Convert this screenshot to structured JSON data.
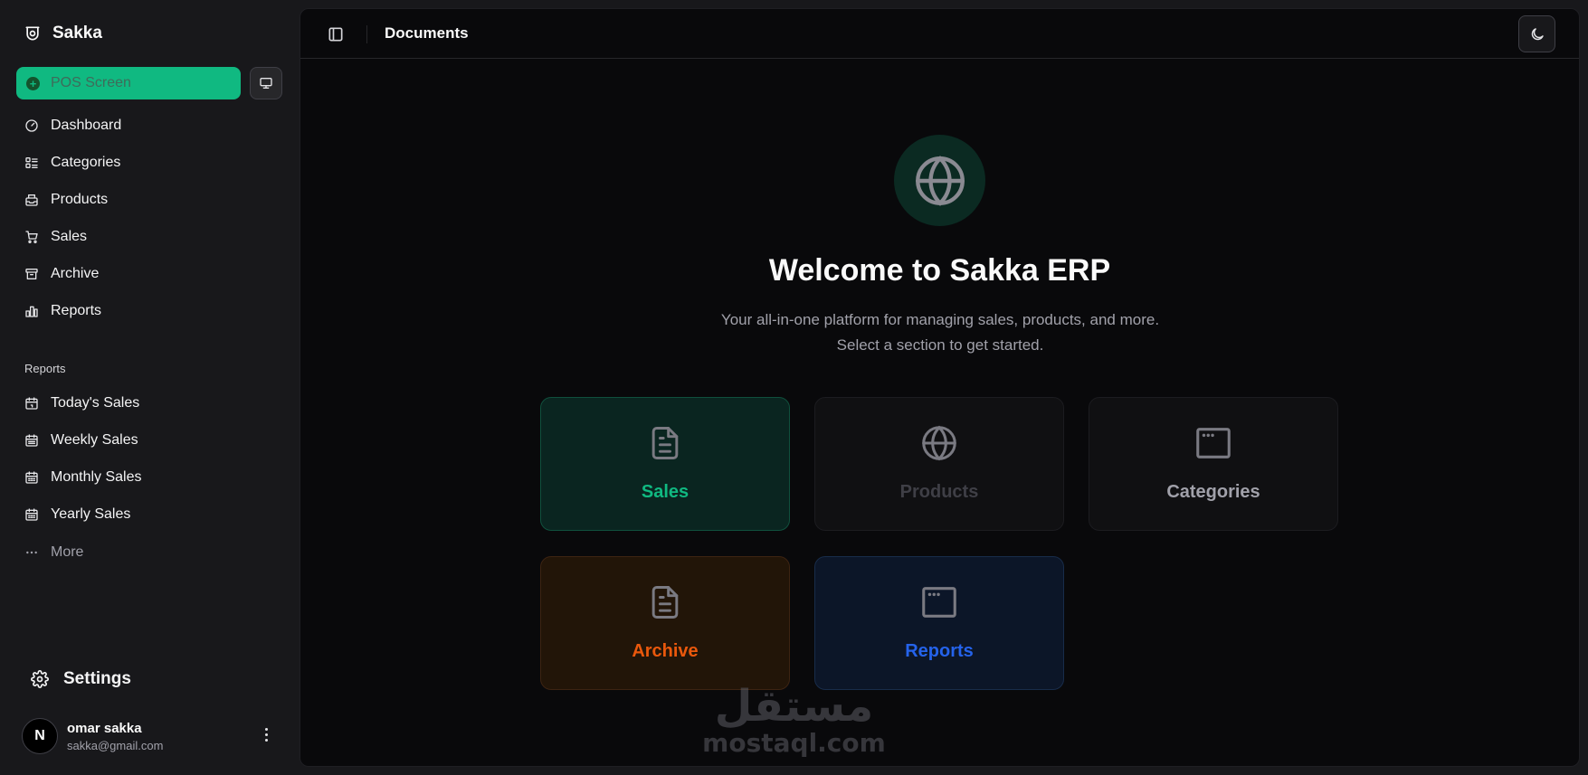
{
  "app": {
    "brand_name": "Sakka",
    "accent_color": "#10b981"
  },
  "sidebar": {
    "pos_button_label": "POS Screen",
    "nav_items": [
      {
        "label": "Dashboard",
        "icon": "gauge-icon"
      },
      {
        "label": "Categories",
        "icon": "list-icon"
      },
      {
        "label": "Products",
        "icon": "inbox-icon"
      },
      {
        "label": "Sales",
        "icon": "cart-icon"
      },
      {
        "label": "Archive",
        "icon": "archive-icon"
      },
      {
        "label": "Reports",
        "icon": "bar-chart-icon"
      }
    ],
    "reports_section_label": "Reports",
    "report_items": [
      {
        "label": "Today's Sales",
        "icon": "calendar-icon"
      },
      {
        "label": "Weekly Sales",
        "icon": "calendar-icon"
      },
      {
        "label": "Monthly Sales",
        "icon": "calendar-icon"
      },
      {
        "label": "Yearly Sales",
        "icon": "calendar-icon"
      }
    ],
    "more_label": "More",
    "settings_label": "Settings",
    "user": {
      "initial": "N",
      "name": "omar sakka",
      "email": "sakka@gmail.com"
    }
  },
  "header": {
    "title": "Documents"
  },
  "main": {
    "welcome_title": "Welcome to Sakka ERP",
    "subtitle": "Your all-in-one platform for managing sales, products, and more. Select a section to get started.",
    "cards": [
      {
        "label": "Sales",
        "icon": "file-text-icon",
        "color": "#10b981"
      },
      {
        "label": "Products",
        "icon": "globe-icon",
        "color": "#3f3f46"
      },
      {
        "label": "Categories",
        "icon": "browser-window-icon",
        "color": "#a1a1aa"
      },
      {
        "label": "Archive",
        "icon": "file-text-icon",
        "color": "#ea580c"
      },
      {
        "label": "Reports",
        "icon": "browser-window-icon",
        "color": "#2563eb"
      }
    ]
  },
  "watermark": {
    "arabic": "مستقل",
    "latin": "mostaql.com"
  }
}
